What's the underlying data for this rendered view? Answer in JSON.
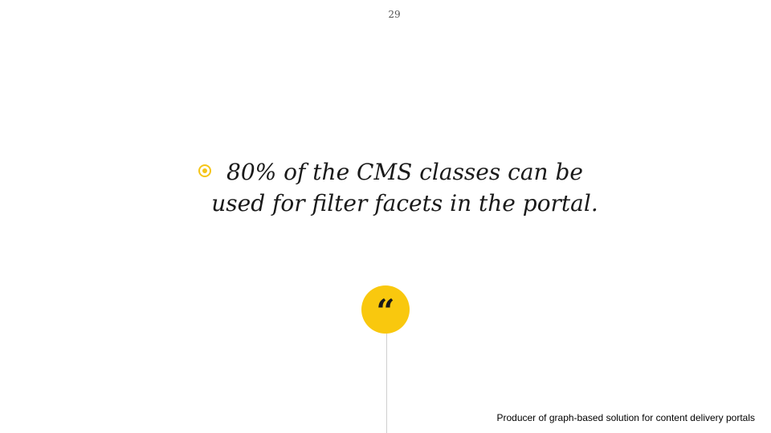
{
  "slide": {
    "page_number": "29",
    "quote_text": "80% of the CMS classes can be used for filter facets in the portal.",
    "quote_mark": "“",
    "footer_text": "Producer of graph-based solution for content delivery portals"
  },
  "colors": {
    "accent": "#F9C80E",
    "text": "#1a1a1a",
    "line": "#cfcfcf"
  },
  "icons": {
    "bullet": "target-bullet-icon",
    "quote": "quote-mark-icon"
  }
}
